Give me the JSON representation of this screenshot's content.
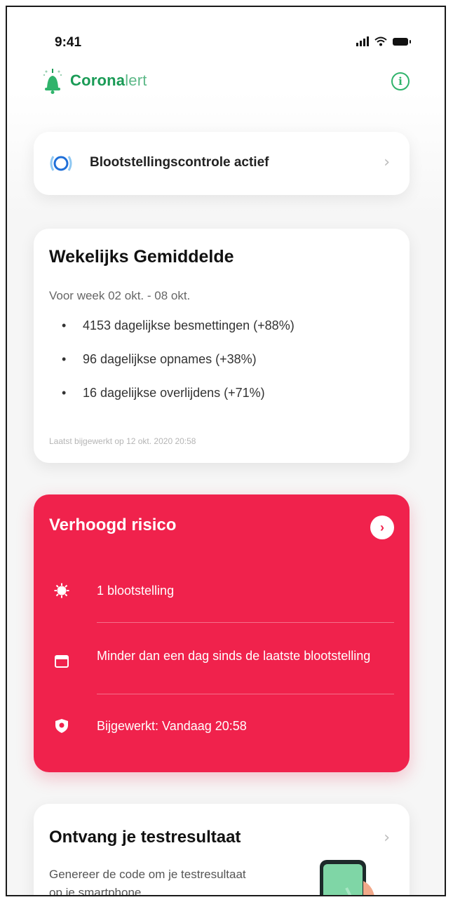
{
  "status_bar": {
    "time": "9:41"
  },
  "header": {
    "brand_part1": "Corona",
    "brand_part2": "lert",
    "info_icon": "info-icon"
  },
  "exposure_check": {
    "label": "Blootstellingscontrole actief"
  },
  "weekly": {
    "title": "Wekelijks Gemiddelde",
    "subtitle": "Voor week 02 okt. - 08 okt.",
    "items": [
      "4153 dagelijkse besmettingen (+88%)",
      "96 dagelijkse opnames (+38%)",
      "16 dagelijkse overlijdens (+71%)"
    ],
    "updated": "Laatst bijgewerkt op 12 okt. 2020 20:58"
  },
  "risk": {
    "title": "Verhoogd risico",
    "rows": [
      {
        "icon": "virus-icon",
        "text": "1 blootstelling"
      },
      {
        "icon": "calendar-icon",
        "text": "Minder dan een dag sinds de laatste blootstelling"
      },
      {
        "icon": "shield-icon",
        "text": "Bijgewerkt: Vandaag 20:58"
      }
    ],
    "accent_color": "#f0224c"
  },
  "test_result": {
    "title": "Ontvang je testresultaat",
    "description": "Genereer de code om je testresultaat op je smartphone"
  },
  "colors": {
    "brand_green": "#1a9b56",
    "risk_red": "#f0224c"
  }
}
